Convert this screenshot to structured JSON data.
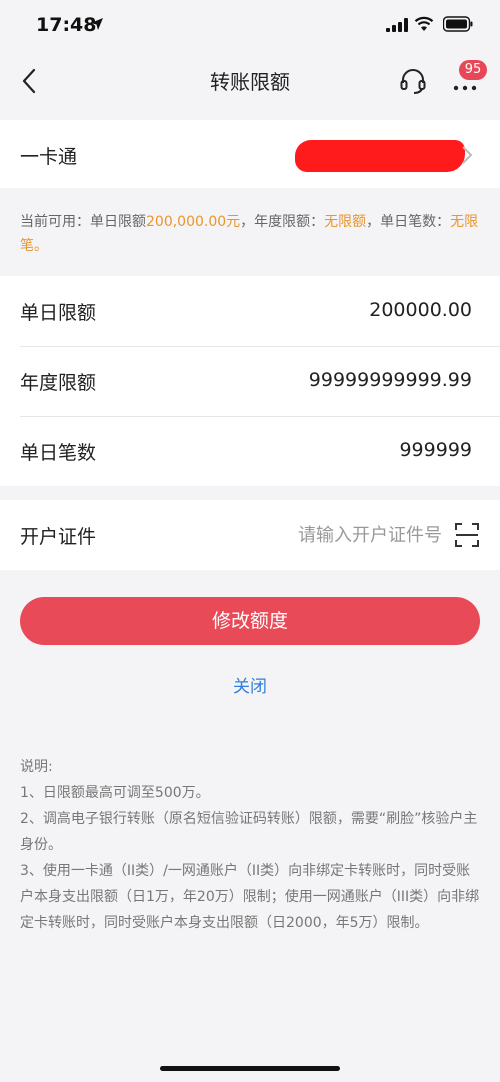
{
  "status_bar": {
    "time": "17:48",
    "icons": [
      "location-arrow-icon",
      "signal-icon",
      "wifi-icon",
      "battery-icon"
    ]
  },
  "nav": {
    "title": "转账限额",
    "badge": "95",
    "icons": [
      "back-icon",
      "headset-icon",
      "more-icon"
    ]
  },
  "card": {
    "label": "一卡通"
  },
  "available": {
    "prefix": "当前可用：单日限额",
    "daily_amount": "200,000.00元",
    "mid1": "，年度限额：",
    "yearly": "无限额",
    "mid2": "，单日笔数：",
    "count": "无限笔。"
  },
  "limits": [
    {
      "label": "单日限额",
      "value": "200000.00"
    },
    {
      "label": "年度限额",
      "value": "99999999999.99"
    },
    {
      "label": "单日笔数",
      "value": "999999"
    }
  ],
  "id_field": {
    "label": "开户证件",
    "placeholder": "请输入开户证件号"
  },
  "buttons": {
    "modify": "修改额度",
    "close": "关闭"
  },
  "notes": {
    "title": "说明:",
    "items": [
      "1、日限额最高可调至500万。",
      "2、调高电子银行转账（原名短信验证码转账）限额，需要“刷脸”核验户主身份。",
      "3、使用一卡通（II类）/一网通账户（II类）向非绑定卡转账时，同时受账户本身支出限额（日1万，年20万）限制；使用一网通账户（III类）向非绑定卡转账时，同时受账户本身支出限额（日2000，年5万）限制。"
    ]
  },
  "colors": {
    "accent_red": "#e84a58",
    "highlight_orange": "#e8962e",
    "link_blue": "#2f7ed8"
  }
}
